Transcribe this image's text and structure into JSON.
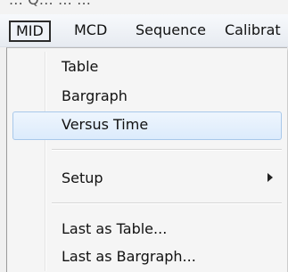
{
  "window": {
    "title_fragment": "... Q... ... ..."
  },
  "menubar": {
    "items": [
      {
        "label": "MID",
        "active": true
      },
      {
        "label": "MCD"
      },
      {
        "label": "Sequence"
      },
      {
        "label": "Calibrat"
      }
    ]
  },
  "mid_menu": {
    "items": [
      {
        "label": "Table"
      },
      {
        "label": "Bargraph"
      },
      {
        "label": "Versus Time",
        "highlighted": true
      },
      {
        "label": "Setup",
        "submenu": true,
        "icon": "submenu-arrow-icon"
      },
      {
        "label": "Last as Table..."
      },
      {
        "label": "Last as Bargraph..."
      }
    ]
  },
  "colors": {
    "highlight_border": "#a8c8ea",
    "highlight_fill": "#dcebfc",
    "menu_background": "#f5f5f5",
    "menubar_background": "#e7ebf1"
  }
}
